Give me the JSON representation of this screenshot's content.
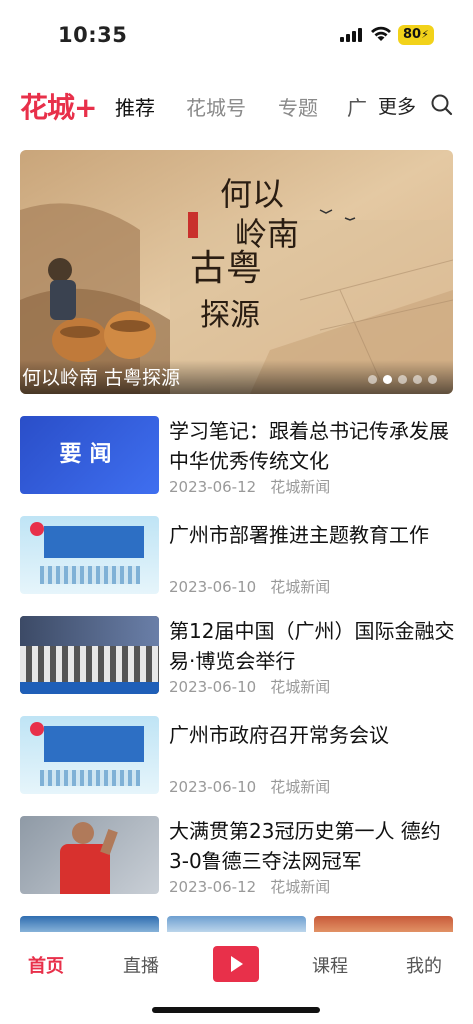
{
  "status": {
    "time": "10:35",
    "battery": "80"
  },
  "nav": {
    "logo": "花城+",
    "tabs": [
      "推荐",
      "花城号",
      "专题",
      "广"
    ],
    "more": "更多"
  },
  "banner": {
    "caption": "何以岭南 古粤探源",
    "art_title": "何以岭南",
    "art_sub": "古粤探源",
    "pages": 5,
    "current": 2
  },
  "news": [
    {
      "title": "学习笔记：跟着总书记传承发展中华优秀传统文化",
      "date": "2023-06-12",
      "source": "花城新闻",
      "thumb_text": "要闻"
    },
    {
      "title": "广州市部署推进主题教育工作",
      "date": "2023-06-10",
      "source": "花城新闻"
    },
    {
      "title": "第12届中国（广州）国际金融交易·博览会举行",
      "date": "2023-06-10",
      "source": "花城新闻"
    },
    {
      "title": "广州市政府召开常务会议",
      "date": "2023-06-10",
      "source": "花城新闻"
    },
    {
      "title": "大满贯第23冠历史第一人 德约3-0鲁德三夺法网冠军",
      "date": "2023-06-12",
      "source": "花城新闻"
    }
  ],
  "tabbar": {
    "home": "首页",
    "live": "直播",
    "course": "课程",
    "mine": "我的"
  },
  "colors": {
    "accent": "#e8304a"
  }
}
